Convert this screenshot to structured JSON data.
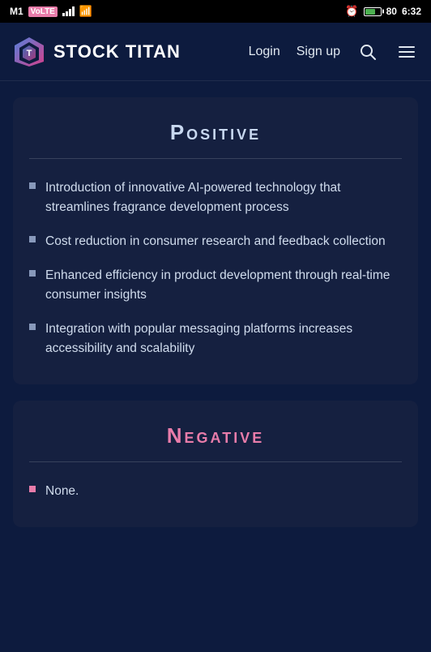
{
  "statusBar": {
    "carrier": "M1",
    "networkType": "VoLTE",
    "time": "6:32",
    "batteryPercent": "80"
  },
  "navbar": {
    "logoText": "STOCK TITAN",
    "loginLabel": "Login",
    "signupLabel": "Sign up"
  },
  "sections": [
    {
      "id": "positive",
      "title": "Positive",
      "titleType": "positive",
      "items": [
        "Introduction of innovative AI-powered technology that streamlines fragrance development process",
        "Cost reduction in consumer research and feedback collection",
        "Enhanced efficiency in product development through real-time consumer insights",
        "Integration with popular messaging platforms increases accessibility and scalability"
      ]
    },
    {
      "id": "negative",
      "title": "Negative",
      "titleType": "negative",
      "items": [
        "None."
      ]
    }
  ]
}
